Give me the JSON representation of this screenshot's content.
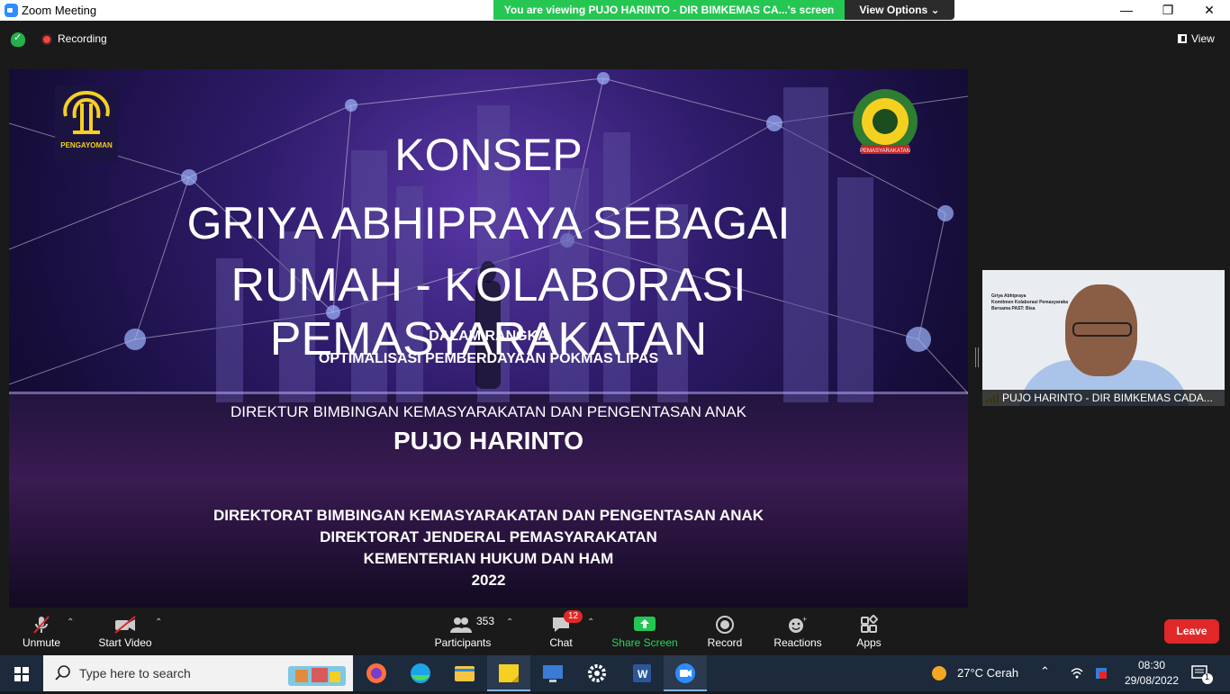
{
  "window": {
    "title": "Zoom Meeting",
    "viewing_banner": "You are viewing PUJO HARINTO - DIR BIMKEMAS CA...'s screen",
    "view_options": "View Options"
  },
  "meeting_top": {
    "recording_label": "Recording",
    "view_label": "View"
  },
  "slide": {
    "logo_left_text": "PENGAYOMAN",
    "logo_right_text": "PEMASYARAKATAN",
    "title_line1": "KONSEP",
    "title_line2": "GRIYA ABHIPRAYA SEBAGAI",
    "title_line3": "RUMAH - KOLABORASI PEMASYARAKATAN",
    "sub_line1": "DALAM RANGKA",
    "sub_line2": "OPTIMALISASI PEMBERDAYAAN POKMAS LIPAS",
    "director_title": "DIREKTUR BIMBINGAN KEMASYARAKATAN DAN PENGENTASAN ANAK",
    "director_name": "PUJO HARINTO",
    "org_line1": "DIREKTORAT BIMBINGAN KEMASYARAKATAN DAN PENGENTASAN ANAK",
    "org_line2": "DIREKTORAT JENDERAL PEMASYARAKATAN",
    "org_line3": "KEMENTERIAN HUKUM DAN HAM",
    "year": "2022"
  },
  "participant": {
    "name": "PUJO HARINTO - DIR BIMKEMAS CADA...",
    "bg_line1": "Griya Abhipraya",
    "bg_line2": "Komitmen Kolaborasi Pemasyaraka",
    "bg_line3": "Bersama PAST: Bisa"
  },
  "toolbar": {
    "unmute": "Unmute",
    "start_video": "Start Video",
    "participants_count": "353",
    "participants": "Participants",
    "chat_badge": "12",
    "chat": "Chat",
    "share_screen": "Share Screen",
    "record": "Record",
    "reactions": "Reactions",
    "apps": "Apps",
    "leave": "Leave"
  },
  "taskbar": {
    "search_placeholder": "Type here to search",
    "weather": "27°C  Cerah",
    "time": "08:30",
    "date": "29/08/2022",
    "notification_count": "1"
  },
  "colors": {
    "zoom_green": "#26c653",
    "leave_red": "#e02828",
    "taskbar_bg": "#1c2a3c"
  }
}
